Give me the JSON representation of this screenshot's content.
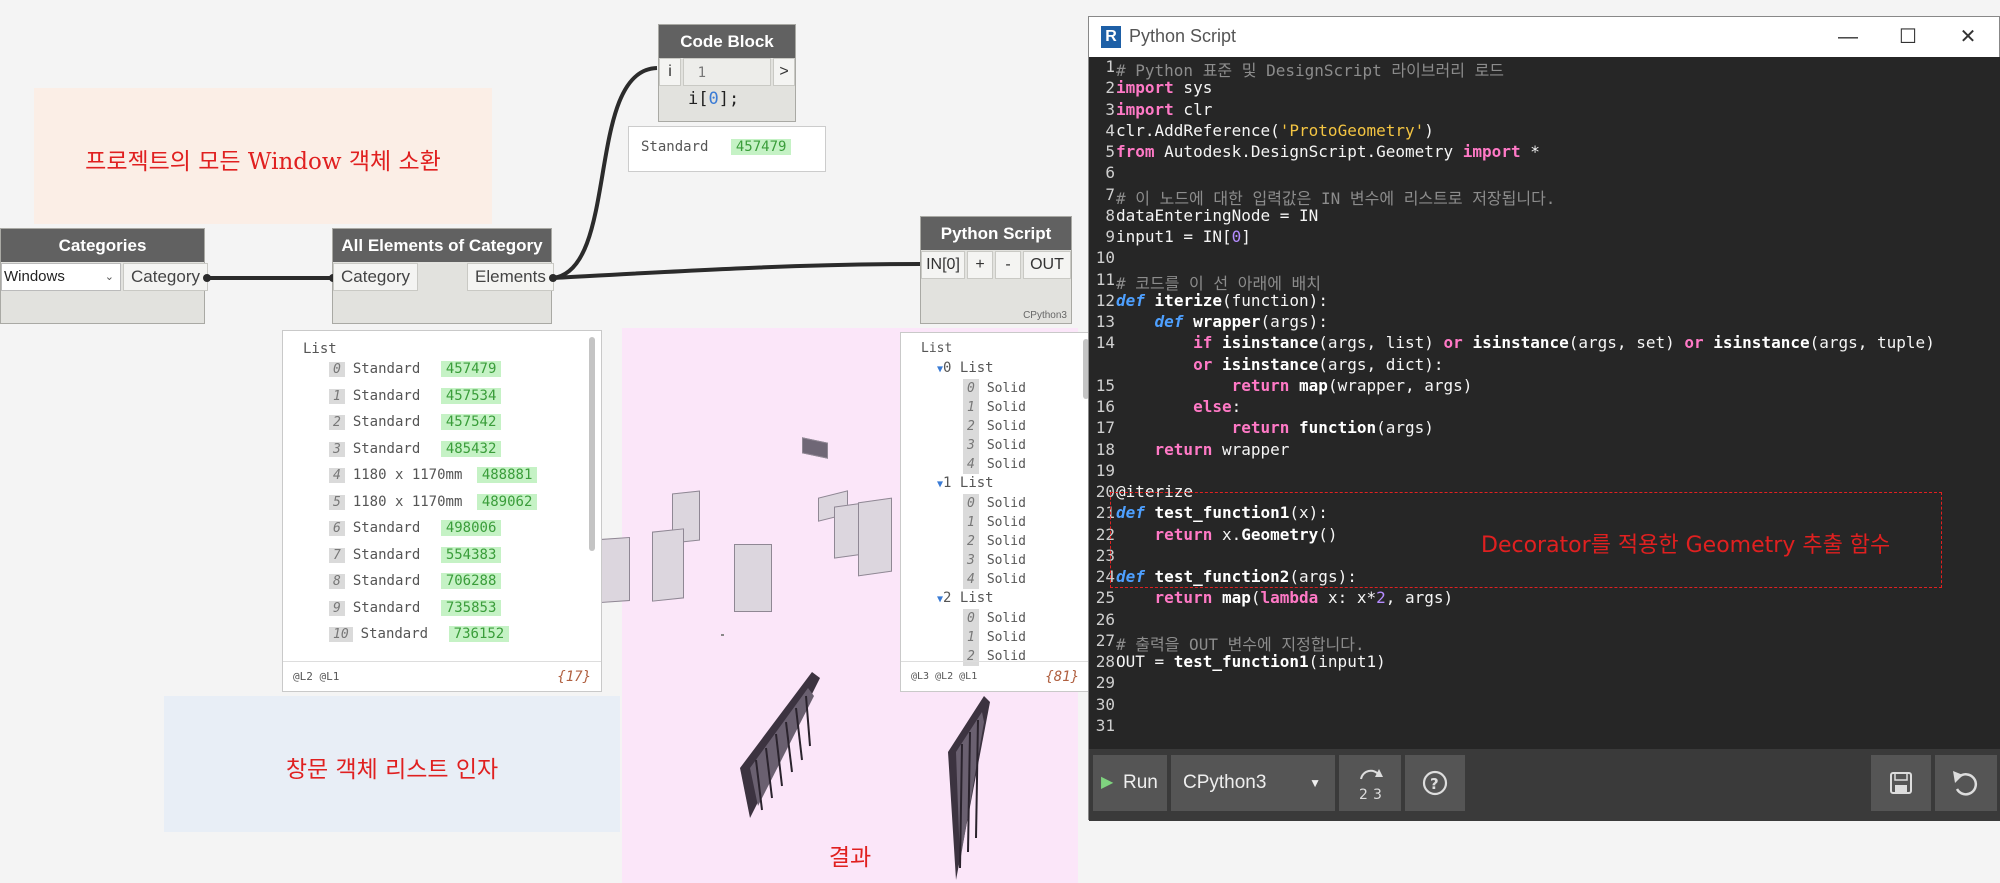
{
  "annotations": {
    "group1_label": "프로젝트의 모든 Window 객체 소환",
    "group2_label": "창문 객체 리스트 인자",
    "group3_label": "결과",
    "decorator_label": "Decorator를 적용한 Geometry 추출 함수",
    "colors": {
      "group1": "#fbeee6",
      "group2": "#e8eef6",
      "group3": "#fbe6f9",
      "annotation_text": "#e02020"
    }
  },
  "nodes": {
    "categories": {
      "title": "Categories",
      "dropdown_value": "Windows",
      "output": "Category"
    },
    "all_elements": {
      "title": "All Elements of Category",
      "input": "Category",
      "output": "Elements"
    },
    "code_block": {
      "title": "Code Block",
      "input": "i",
      "line_number": "1",
      "code_prefix": "i[",
      "code_index": "0",
      "code_suffix": "];",
      "output": ">",
      "preview_label": "Standard",
      "preview_value": "457479"
    },
    "python_script": {
      "title": "Python Script",
      "input": "IN[0]",
      "add": "+",
      "remove": "-",
      "output": "OUT",
      "engine_tag": "CPython3"
    }
  },
  "watch_elements": {
    "header": "List",
    "items": [
      {
        "index": "0",
        "label": "Standard",
        "id": "457479"
      },
      {
        "index": "1",
        "label": "Standard",
        "id": "457534"
      },
      {
        "index": "2",
        "label": "Standard",
        "id": "457542"
      },
      {
        "index": "3",
        "label": "Standard",
        "id": "485432"
      },
      {
        "index": "4",
        "label": "1180 x 1170mm",
        "id": "488881"
      },
      {
        "index": "5",
        "label": "1180 x 1170mm",
        "id": "489062"
      },
      {
        "index": "6",
        "label": "Standard",
        "id": "498006"
      },
      {
        "index": "7",
        "label": "Standard",
        "id": "554383"
      },
      {
        "index": "8",
        "label": "Standard",
        "id": "706288"
      },
      {
        "index": "9",
        "label": "Standard",
        "id": "735853"
      },
      {
        "index": "10",
        "label": "Standard",
        "id": "736152"
      }
    ],
    "levels": "@L2 @L1",
    "count": "{17}"
  },
  "watch_python": {
    "header": "List",
    "groups": [
      {
        "label": "0 List",
        "items": [
          "0",
          "1",
          "2",
          "3",
          "4"
        ]
      },
      {
        "label": "1 List",
        "items": [
          "0",
          "1",
          "2",
          "3",
          "4"
        ]
      },
      {
        "label": "2 List",
        "items": [
          "0",
          "1",
          "2"
        ]
      }
    ],
    "item_label": "Solid",
    "levels": "@L3 @L2 @L1",
    "count": "{81}"
  },
  "python_window": {
    "title": "Python Script",
    "logo": "R",
    "minimize": "—",
    "maximize": "☐",
    "close": "✕",
    "run_label": "Run",
    "engine": "CPython3",
    "code_lines": [
      "# Python 표준 및 DesignScript 라이브러리 로드",
      "import sys",
      "import clr",
      "clr.AddReference('ProtoGeometry')",
      "from Autodesk.DesignScript.Geometry import *",
      "",
      "# 이 노드에 대한 입력값은 IN 변수에 리스트로 저장됩니다.",
      "dataEnteringNode = IN",
      "input1 = IN[0]",
      "",
      "# 코드를 이 선 아래에 배치",
      "def iterize(function):",
      "    def wrapper(args):",
      "        if isinstance(args, list) or isinstance(args, set) or isinstance(args, tuple)",
      "        or isinstance(args, dict):",
      "            return map(wrapper, args)",
      "        else:",
      "            return function(args)",
      "    return wrapper",
      "",
      "@iterize",
      "def test_function1(x):",
      "    return x.Geometry()",
      "",
      "def test_function2(args):",
      "    return map(lambda x: x*2, args)",
      "",
      "# 출력을 OUT 변수에 지정합니다.",
      "OUT = test_function1(input1)"
    ],
    "line_numbers": [
      "1",
      "2",
      "3",
      "4",
      "5",
      "6",
      "7",
      "8",
      "9",
      "10",
      "11",
      "12",
      "13",
      "14",
      "",
      "15",
      "16",
      "17",
      "18",
      "19",
      "20",
      "21",
      "22",
      "23",
      "24",
      "25",
      "26",
      "27",
      "28",
      "29",
      "30",
      "31"
    ]
  }
}
